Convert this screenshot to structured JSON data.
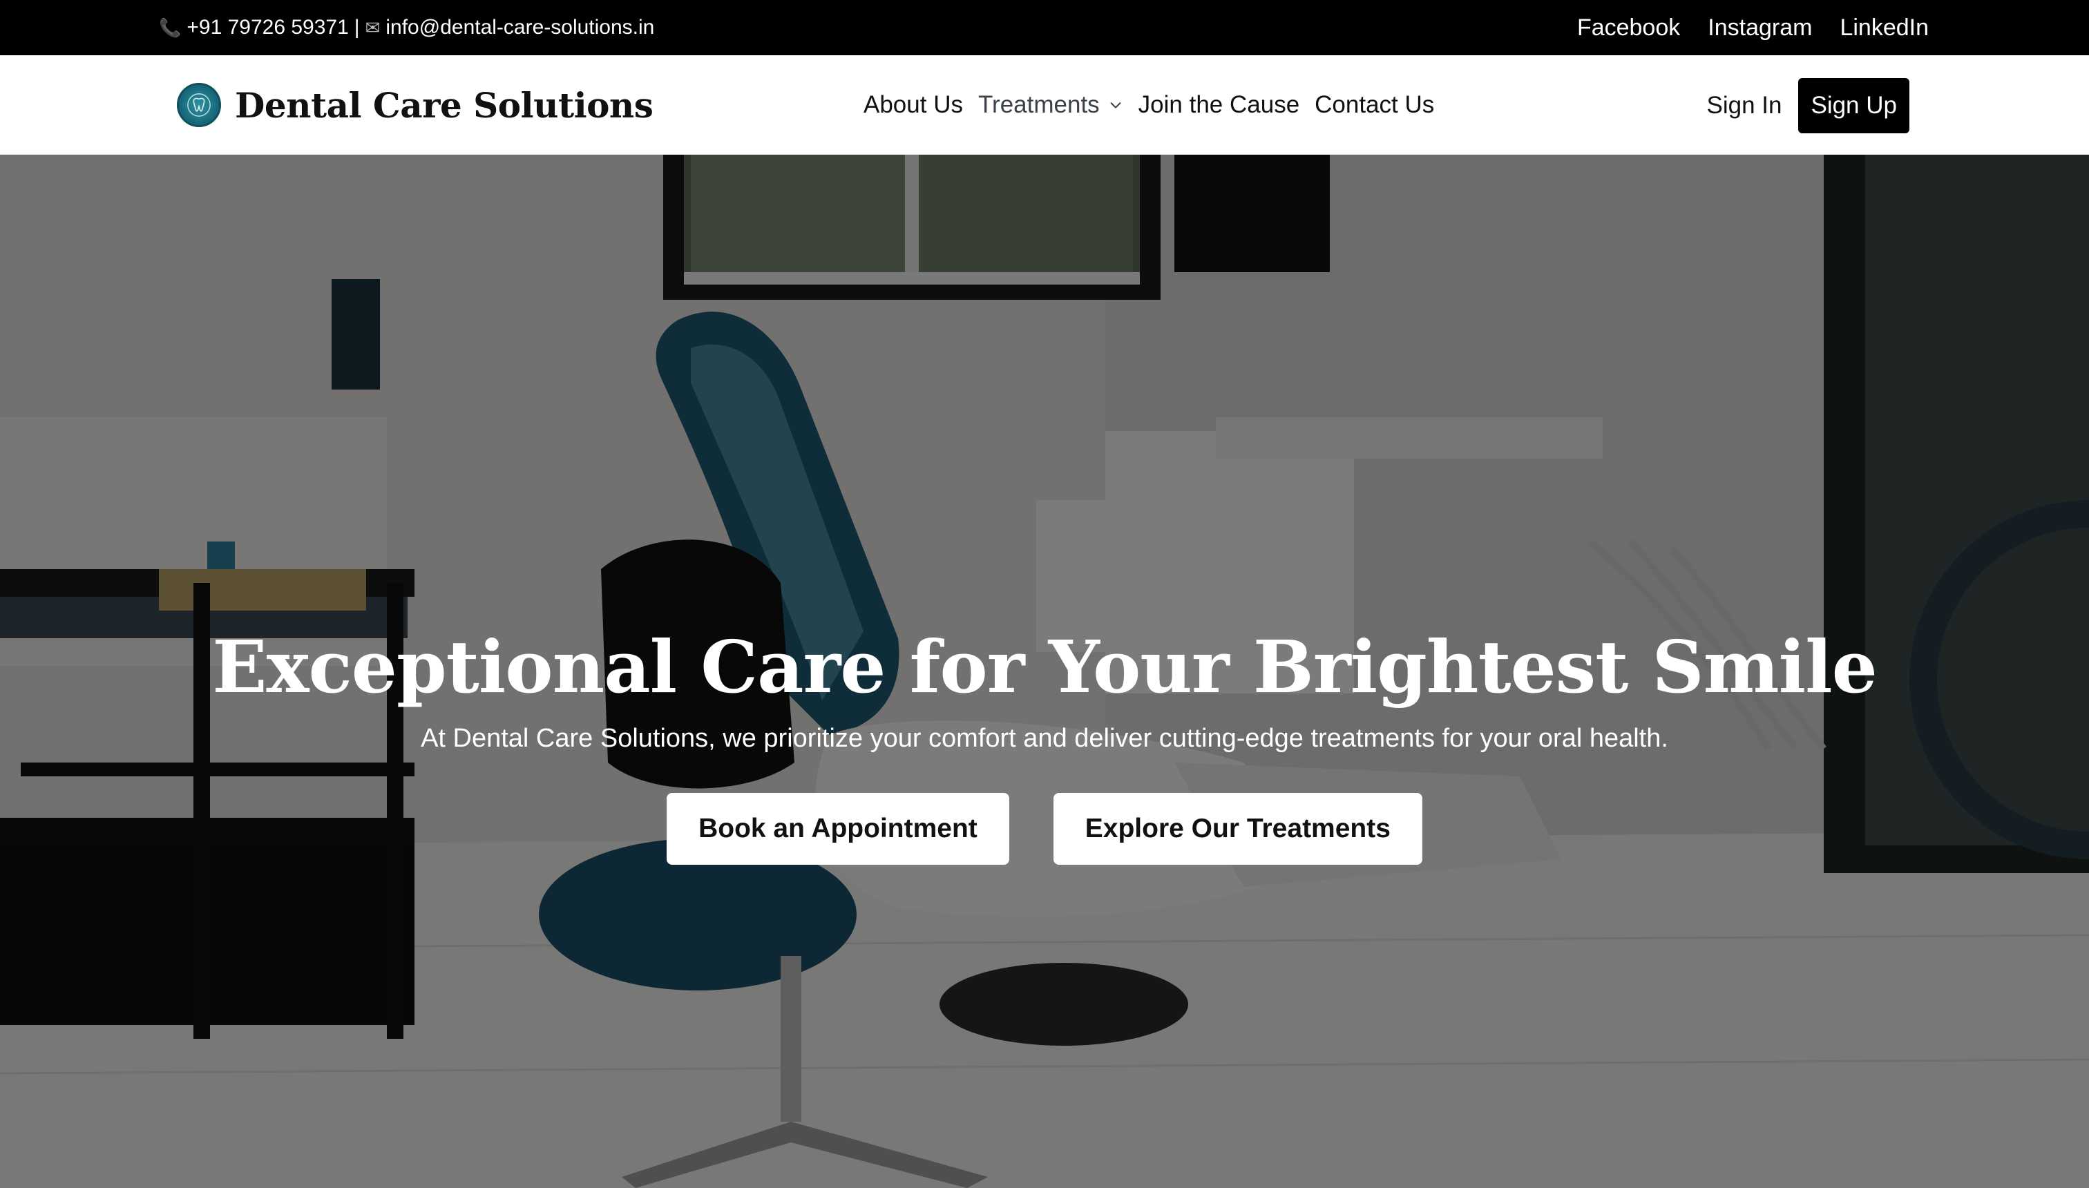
{
  "topbar": {
    "phone": "+91 79726 59371",
    "separator": "|",
    "email": "info@dental-care-solutions.in",
    "social": [
      "Facebook",
      "Instagram",
      "LinkedIn"
    ]
  },
  "nav": {
    "brand": "Dental Care Solutions",
    "items": [
      "About Us",
      "Treatments",
      "Join the Cause",
      "Contact Us"
    ],
    "sign_in": "Sign In",
    "sign_up": "Sign Up"
  },
  "hero": {
    "title": "Exceptional Care for Your Brightest Smile",
    "subtitle": "At Dental Care Solutions, we prioritize your comfort and deliver cutting-edge treatments for your oral health.",
    "primary_cta": "Book an Appointment",
    "secondary_cta": "Explore Our Treatments"
  },
  "colors": {
    "topbar_bg": "#000000",
    "brand_teal": "#1b6f80",
    "button_dark": "#000000"
  },
  "icons": {
    "phone": "phone-icon",
    "email": "email-icon",
    "logo": "tooth-logo-icon",
    "dropdown": "chevron-down-icon"
  }
}
